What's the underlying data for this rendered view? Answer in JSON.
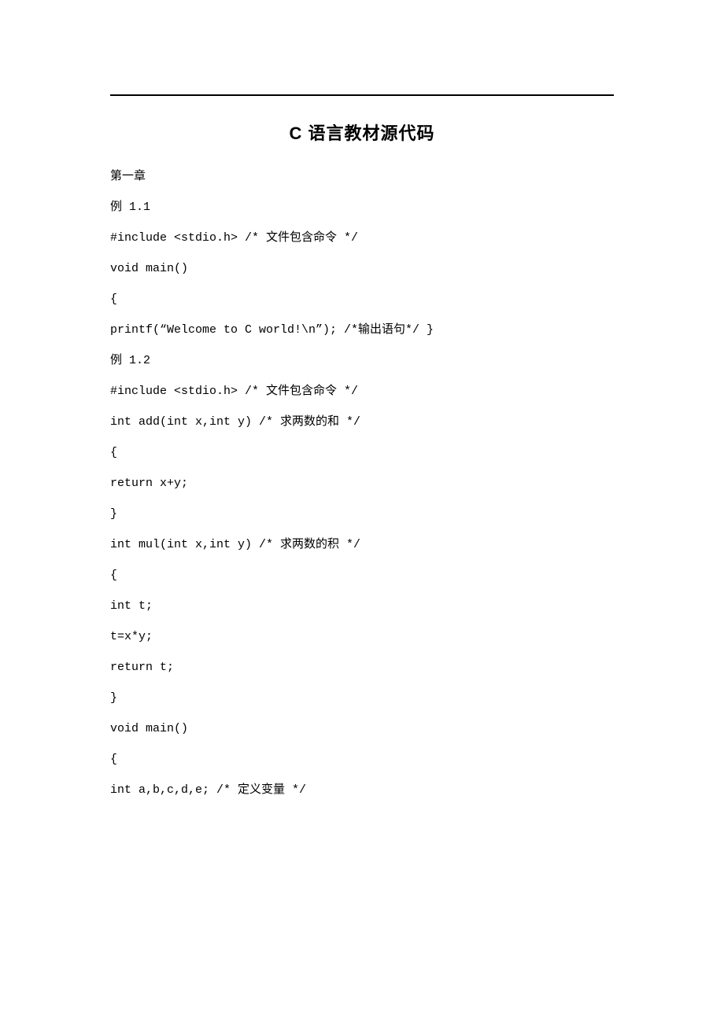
{
  "title": "C 语言教材源代码",
  "lines": [
    "第一章",
    "例 1.1",
    "#include <stdio.h> /* 文件包含命令 */",
    "void main()",
    "{",
    "printf(“Welcome to C world!\\n”); /*输出语句*/ }",
    "例 1.2",
    "#include <stdio.h> /* 文件包含命令 */",
    "int add(int x,int y) /* 求两数的和 */",
    "{",
    "return x+y;",
    "}",
    "int mul(int x,int y) /* 求两数的积 */",
    "{",
    "int t;",
    "t=x*y;",
    "return t;",
    "}",
    "void main()",
    "{",
    "int a,b,c,d,e; /* 定义变量 */"
  ]
}
